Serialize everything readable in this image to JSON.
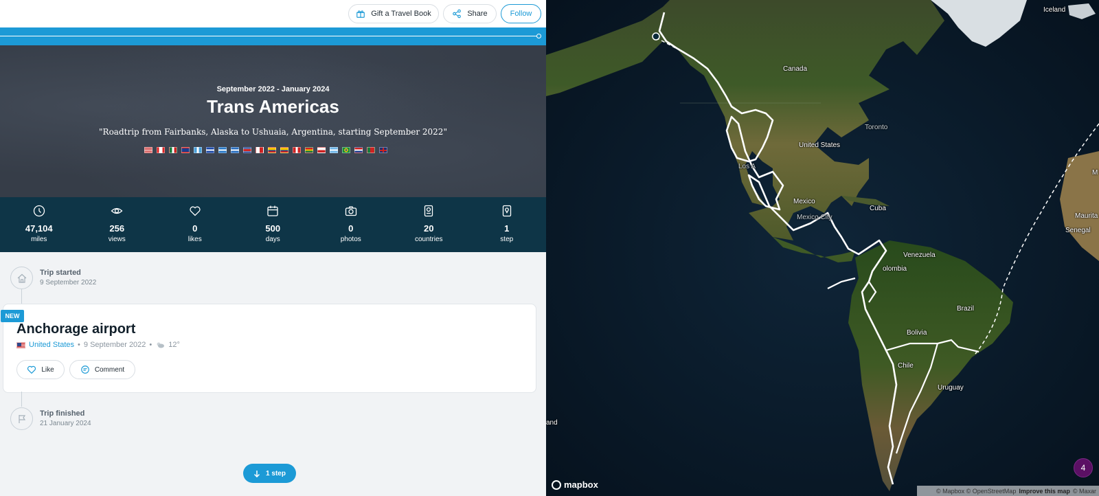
{
  "header": {
    "gift_label": "Gift a Travel Book",
    "share_label": "Share",
    "follow_label": "Follow"
  },
  "trip": {
    "dates": "September 2022 - January 2024",
    "title": "Trans Americas",
    "subtitle": "\"Roadtrip from Fairbanks, Alaska to Ushuaia, Argentina, starting September 2022\"",
    "flags": [
      "us-flag",
      "ca-flag",
      "mx-flag",
      "bz-flag",
      "gt-flag",
      "sv-flag",
      "hn-flag",
      "ni-flag",
      "cr-flag",
      "pa-flag",
      "co-flag",
      "ec-flag",
      "pe-flag",
      "bo-flag",
      "cl-flag",
      "ar-flag",
      "br-flag",
      "py-flag",
      "pt-flag",
      "gb-flag"
    ]
  },
  "stats": [
    {
      "icon": "compass-icon",
      "value": "47,104",
      "label": "miles"
    },
    {
      "icon": "eye-icon",
      "value": "256",
      "label": "views"
    },
    {
      "icon": "heart-icon",
      "value": "0",
      "label": "likes"
    },
    {
      "icon": "calendar-icon",
      "value": "500",
      "label": "days"
    },
    {
      "icon": "camera-icon",
      "value": "0",
      "label": "photos"
    },
    {
      "icon": "passport-icon",
      "value": "20",
      "label": "countries"
    },
    {
      "icon": "map-pin-icon",
      "value": "1",
      "label": "step"
    }
  ],
  "timeline": {
    "start_title": "Trip started",
    "start_date": "9 September 2022",
    "end_title": "Trip finished",
    "end_date": "21 January 2024"
  },
  "step": {
    "badge": "NEW",
    "title": "Anchorage airport",
    "country": "United States",
    "date": "9 September 2022",
    "weather_icon": "partly-cloudy-icon",
    "temperature": "12°",
    "like_label": "Like",
    "comment_label": "Comment"
  },
  "steps_button": "1 step",
  "map": {
    "labels": {
      "iceland": "Iceland",
      "canada": "Canada",
      "toronto": "Toronto",
      "united_states": "United States",
      "los_angeles": "Los A",
      "mexico": "Mexico",
      "mexico_city": "Mexico City",
      "cuba": "Cuba",
      "venezuela": "Venezuela",
      "colombia": "olombia",
      "brazil": "Brazil",
      "bolivia": "Bolivia",
      "chile": "Chile",
      "uruguay": "Uruguay",
      "senegal": "Senegal",
      "mauritania": "Maurita",
      "edge_m": "M",
      "edge_land": "and"
    },
    "brand": "mapbox",
    "attribution_1": "© Mapbox © OpenStreetMap",
    "attribution_2": "Improve this map",
    "attribution_3": "© Maxar",
    "cluster_count": "4"
  }
}
